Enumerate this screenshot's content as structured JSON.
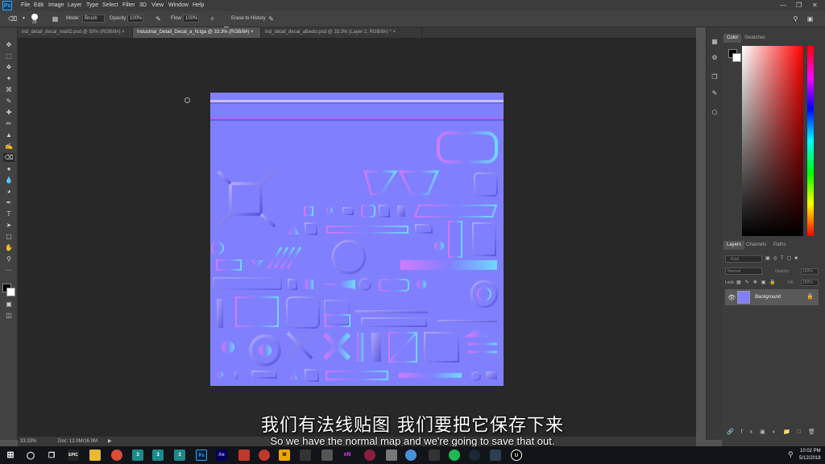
{
  "app": {
    "logo": "Ps"
  },
  "menu": [
    "File",
    "Edit",
    "Image",
    "Layer",
    "Type",
    "Select",
    "Filter",
    "3D",
    "View",
    "Window",
    "Help"
  ],
  "options": {
    "brush_size": "28",
    "mode_label": "Mode:",
    "mode_value": "Brush",
    "opacity_label": "Opacity:",
    "opacity_value": "100%",
    "flow_label": "Flow:",
    "flow_value": "100%",
    "erase_history_label": "Erase to History"
  },
  "tabs": [
    {
      "label": "ind_detail_decal_matID.psd @ 50% (RGB/8#)",
      "active": false
    },
    {
      "label": "Industrial_Detail_Decal_a_N.tga @ 33.3% (RGB/8#)",
      "active": true
    },
    {
      "label": "ind_detail_decal_albedo.psd @ 33.3% (Layer 2, RGB/8#) *",
      "active": false
    }
  ],
  "status": {
    "zoom": "33.33%",
    "doc": "Doc: 12.0M/16.0M"
  },
  "panels": {
    "color_tab": "Color",
    "swatches_tab": "Swatches",
    "layers_tab": "Layers",
    "channels_tab": "Channels",
    "paths_tab": "Paths",
    "kind_placeholder": "Kind",
    "blend_mode": "Normal",
    "opacity_label": "Opacity:",
    "opacity_value": "100%",
    "lock_label": "Lock:",
    "fill_label": "Fill:",
    "fill_value": "100%",
    "layer_name": "Background"
  },
  "subtitles": {
    "chinese": "我们有法线贴图 我们要把它保存下来",
    "english": "So we have the normal map and we're going to save that out."
  },
  "taskbar": {
    "time": "10:02 PM",
    "date": "5/12/2018",
    "icons": [
      "windows-icon",
      "search-icon",
      "taskview-icon",
      "epic-icon",
      "explorer-icon",
      "chrome-icon",
      "3dsmax-icon",
      "3dsmax-icon",
      "photoshop-icon",
      "after-effects-icon",
      "app-icon",
      "app-icon",
      "marmoset-icon",
      "app-icon",
      "app-icon",
      "app-icon",
      "xnormal-icon",
      "app-icon",
      "app-icon",
      "app-icon",
      "spotify-icon",
      "steam-icon",
      "app-icon",
      "unreal-icon"
    ]
  },
  "colors": {
    "normal_map_base": "#8080fe",
    "canvas_bg": "#282828",
    "ui_bg": "#535353"
  }
}
